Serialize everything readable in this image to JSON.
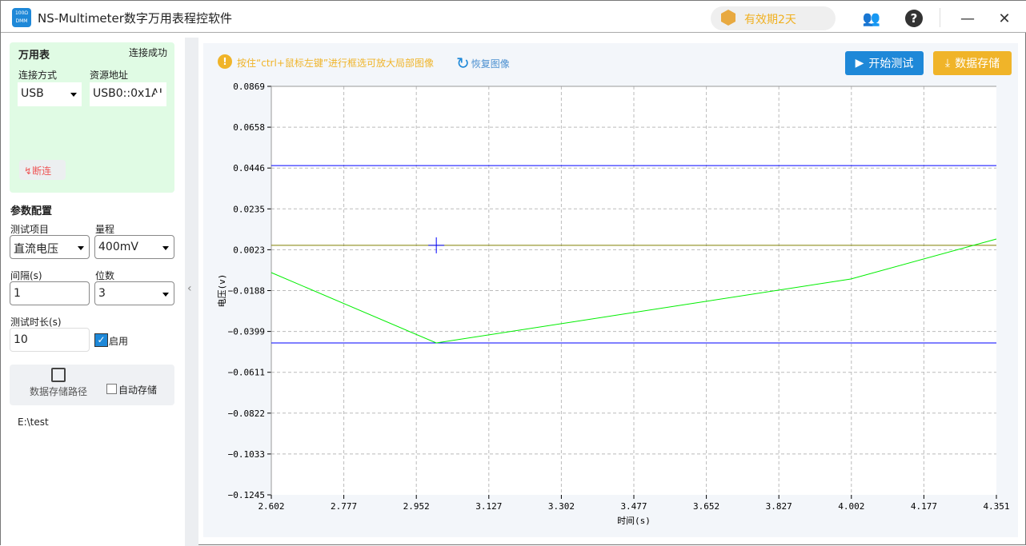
{
  "app": {
    "title": "NS-Multimeter数字万用表程控软件",
    "logo_text": "100Ω DMM",
    "license": "有效期2天"
  },
  "device": {
    "title": "万用表",
    "status": "连接成功",
    "conn_label": "连接方式",
    "conn_value": "USB",
    "addr_label": "资源地址",
    "addr_value": "USB0::0x1AI",
    "disconnect": "断连"
  },
  "params": {
    "title": "参数配置",
    "item_label": "测试项目",
    "item_value": "直流电压",
    "range_label": "量程",
    "range_value": "400mV",
    "interval_label": "间隔(s)",
    "interval_value": "1",
    "digits_label": "位数",
    "digits_value": "3",
    "duration_label": "测试时长(s)",
    "duration_value": "10",
    "enable_label": "启用",
    "enable_checked": true
  },
  "storage": {
    "path_button": "数据存储路径",
    "auto_label": "自动存储",
    "auto_checked": false,
    "path": "E:\\test"
  },
  "toolbar": {
    "hint": "按住“ctrl+鼠标左键”进行框选可放大局部图像",
    "restore": "恢复图像",
    "start": "开始测试",
    "save": "数据存储"
  },
  "colors": {
    "primary": "#1e88d8",
    "warning": "#f0b429",
    "series": "#00ee00",
    "limit": "#0000ff",
    "level": "#808000"
  },
  "chart_data": {
    "type": "line",
    "xlabel": "时间(s)",
    "ylabel": "电压(v)",
    "xlim": [
      2.602,
      4.351
    ],
    "ylim": [
      -0.1245,
      0.0869
    ],
    "xticks": [
      "2.602",
      "2.777",
      "2.952",
      "3.127",
      "3.302",
      "3.477",
      "3.652",
      "3.827",
      "4.002",
      "4.177",
      "4.351"
    ],
    "yticks": [
      "0.0869",
      "0.0658",
      "0.0446",
      "0.0235",
      "0.0023",
      "-0.0188",
      "-0.0399",
      "-0.0611",
      "-0.0822",
      "-0.1033",
      "-0.1245"
    ],
    "grid": true,
    "series": [
      {
        "x": [
          2.602,
          3.0,
          4.0,
          4.351
        ],
        "y": [
          -0.0095,
          -0.0459,
          -0.0128,
          0.0079
        ]
      }
    ],
    "hlines": [
      {
        "y": 0.0459,
        "color": "#0000ff"
      },
      {
        "y": -0.0459,
        "color": "#0000ff"
      },
      {
        "y": 0.0046,
        "color": "#808000"
      }
    ],
    "marker": {
      "x": 3.0,
      "y": 0.0046
    }
  }
}
